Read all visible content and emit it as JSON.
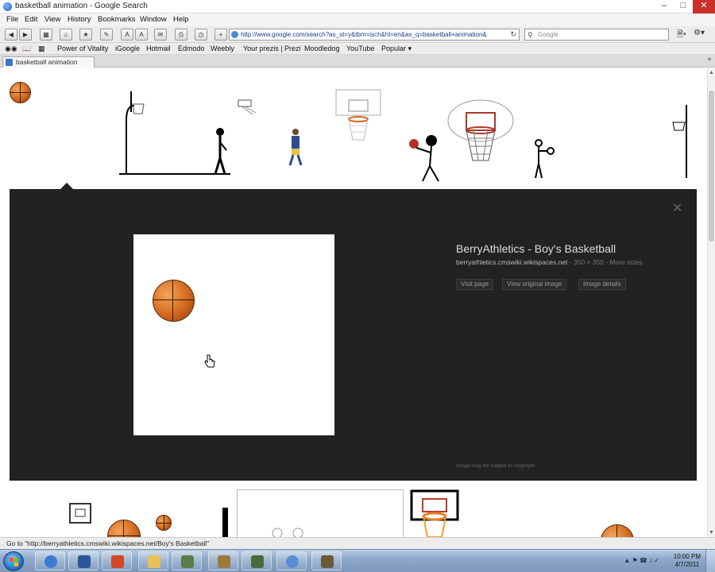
{
  "window": {
    "title": "basketball animation - Google Search"
  },
  "menu": [
    "File",
    "Edit",
    "View",
    "History",
    "Bookmarks",
    "Window",
    "Help"
  ],
  "toolbar": {
    "url": "http://www.google.com/search?as_st=y&tbm=isch&hl=en&as_q=basketball+animation&",
    "search_placeholder": "Google"
  },
  "bookmarks": [
    "Power of Vitality",
    "iGoogle",
    "Hotmail",
    "Edmodo",
    "Weebly",
    "Your prezis | Prezi",
    "Moodledog",
    "YouTube",
    "Popular ▾"
  ],
  "tab": {
    "label": "basketball animation"
  },
  "preview": {
    "title": "BerryAthletics - Boy's Basketball",
    "domain": "berryathletics.cmswiki.wikispaces.net",
    "dims": "350 × 350",
    "more_sizes": "More sizes",
    "buttons": [
      "Visit page",
      "View original image",
      "Image details"
    ],
    "copyright": "Image may be subject to copyright."
  },
  "status": {
    "text": "Go to \"http://berryathletics.cmswiki.wikispaces.net/Boy's Basketball\""
  },
  "clock": {
    "time": "10:00 PM",
    "date": "4/7/2011"
  },
  "colors": {
    "preview_bg": "#222222",
    "ball": "#d2691e",
    "taskbar": "#8ea9c9"
  }
}
